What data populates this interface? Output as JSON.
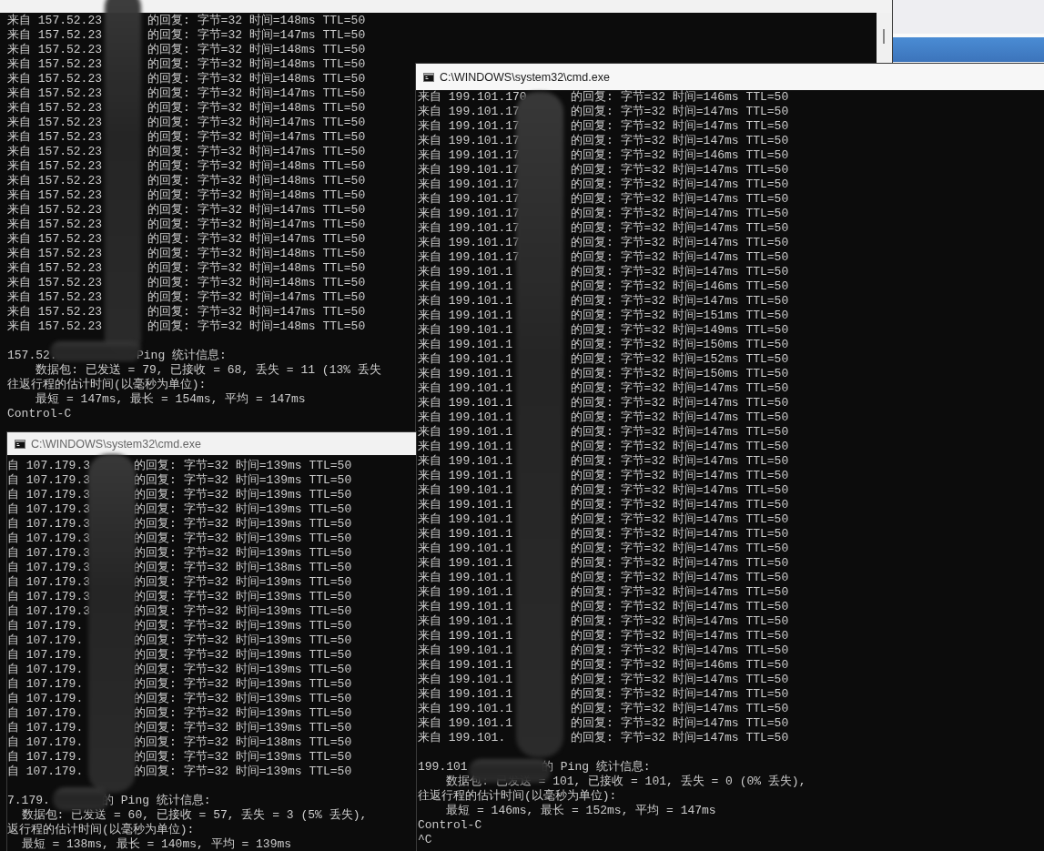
{
  "windows": [
    {
      "replies": [
        {
          "source": "来自 157.52.23",
          "reply": "的回复: 字节=32 时间=148ms TTL=50"
        },
        {
          "source": "来自 157.52.23",
          "reply": "的回复: 字节=32 时间=147ms TTL=50"
        },
        {
          "source": "来自 157.52.23",
          "reply": "的回复: 字节=32 时间=148ms TTL=50"
        },
        {
          "source": "来自 157.52.23",
          "reply": "的回复: 字节=32 时间=148ms TTL=50"
        },
        {
          "source": "来自 157.52.23",
          "reply": "的回复: 字节=32 时间=148ms TTL=50"
        },
        {
          "source": "来自 157.52.23",
          "reply": "的回复: 字节=32 时间=147ms TTL=50"
        },
        {
          "source": "来自 157.52.23",
          "reply": "的回复: 字节=32 时间=148ms TTL=50"
        },
        {
          "source": "来自 157.52.23",
          "reply": "的回复: 字节=32 时间=147ms TTL=50"
        },
        {
          "source": "来自 157.52.23",
          "reply": "的回复: 字节=32 时间=147ms TTL=50"
        },
        {
          "source": "来自 157.52.23",
          "reply": "的回复: 字节=32 时间=147ms TTL=50"
        },
        {
          "source": "来自 157.52.23",
          "reply": "的回复: 字节=32 时间=148ms TTL=50"
        },
        {
          "source": "来自 157.52.23",
          "reply": "的回复: 字节=32 时间=148ms TTL=50"
        },
        {
          "source": "来自 157.52.23",
          "reply": "的回复: 字节=32 时间=148ms TTL=50"
        },
        {
          "source": "来自 157.52.23",
          "reply": "的回复: 字节=32 时间=147ms TTL=50"
        },
        {
          "source": "来自 157.52.23",
          "reply": "的回复: 字节=32 时间=147ms TTL=50"
        },
        {
          "source": "来自 157.52.23",
          "reply": "的回复: 字节=32 时间=147ms TTL=50"
        },
        {
          "source": "来自 157.52.23",
          "reply": "的回复: 字节=32 时间=148ms TTL=50"
        },
        {
          "source": "来自 157.52.23",
          "reply": "的回复: 字节=32 时间=148ms TTL=50"
        },
        {
          "source": "来自 157.52.23",
          "reply": "的回复: 字节=32 时间=148ms TTL=50"
        },
        {
          "source": "来自 157.52.23",
          "reply": "的回复: 字节=32 时间=147ms TTL=50"
        },
        {
          "source": "来自 157.52.23",
          "reply": "的回复: 字节=32 时间=147ms TTL=50"
        },
        {
          "source": "来自 157.52.23",
          "reply": "的回复: 字节=32 时间=148ms TTL=50"
        }
      ],
      "stats_header": {
        "source": "157.52.",
        "text": "Ping 统计信息:"
      },
      "stats": [
        "    数据包: 已发送 = 79, 已接收 = 68, 丢失 = 11 (13% 丢失",
        "往返行程的估计时间(以毫秒为单位):",
        "    最短 = 147ms, 最长 = 154ms, 平均 = 147ms",
        "Control-C"
      ]
    },
    {
      "title": "C:\\WINDOWS\\system32\\cmd.exe",
      "replies": [
        {
          "source": "来自 199.101.170",
          "reply": "的回复: 字节=32 时间=146ms TTL=50"
        },
        {
          "source": "来自 199.101.17",
          "reply": "的回复: 字节=32 时间=147ms TTL=50"
        },
        {
          "source": "来自 199.101.17",
          "reply": "的回复: 字节=32 时间=147ms TTL=50"
        },
        {
          "source": "来自 199.101.17",
          "reply": "的回复: 字节=32 时间=147ms TTL=50"
        },
        {
          "source": "来自 199.101.17",
          "reply": "的回复: 字节=32 时间=146ms TTL=50"
        },
        {
          "source": "来自 199.101.17",
          "reply": "的回复: 字节=32 时间=147ms TTL=50"
        },
        {
          "source": "来自 199.101.17",
          "reply": "的回复: 字节=32 时间=147ms TTL=50"
        },
        {
          "source": "来自 199.101.17",
          "reply": "的回复: 字节=32 时间=147ms TTL=50"
        },
        {
          "source": "来自 199.101.17",
          "reply": "的回复: 字节=32 时间=147ms TTL=50"
        },
        {
          "source": "来自 199.101.17",
          "reply": "的回复: 字节=32 时间=147ms TTL=50"
        },
        {
          "source": "来自 199.101.17",
          "reply": "的回复: 字节=32 时间=147ms TTL=50"
        },
        {
          "source": "来自 199.101.17",
          "reply": "的回复: 字节=32 时间=147ms TTL=50"
        },
        {
          "source": "来自 199.101.1",
          "reply": "的回复: 字节=32 时间=147ms TTL=50"
        },
        {
          "source": "来自 199.101.1",
          "reply": "的回复: 字节=32 时间=146ms TTL=50"
        },
        {
          "source": "来自 199.101.1",
          "reply": "的回复: 字节=32 时间=147ms TTL=50"
        },
        {
          "source": "来自 199.101.1",
          "reply": "的回复: 字节=32 时间=151ms TTL=50"
        },
        {
          "source": "来自 199.101.1",
          "reply": "的回复: 字节=32 时间=149ms TTL=50"
        },
        {
          "source": "来自 199.101.1",
          "reply": "的回复: 字节=32 时间=150ms TTL=50"
        },
        {
          "source": "来自 199.101.1",
          "reply": "的回复: 字节=32 时间=152ms TTL=50"
        },
        {
          "source": "来自 199.101.1",
          "reply": "的回复: 字节=32 时间=150ms TTL=50"
        },
        {
          "source": "来自 199.101.1",
          "reply": "的回复: 字节=32 时间=147ms TTL=50"
        },
        {
          "source": "来自 199.101.1",
          "reply": "的回复: 字节=32 时间=147ms TTL=50"
        },
        {
          "source": "来自 199.101.1",
          "reply": "的回复: 字节=32 时间=147ms TTL=50"
        },
        {
          "source": "来自 199.101.1",
          "reply": "的回复: 字节=32 时间=147ms TTL=50"
        },
        {
          "source": "来自 199.101.1",
          "reply": "的回复: 字节=32 时间=147ms TTL=50"
        },
        {
          "source": "来自 199.101.1",
          "reply": "的回复: 字节=32 时间=147ms TTL=50"
        },
        {
          "source": "来自 199.101.1",
          "reply": "的回复: 字节=32 时间=147ms TTL=50"
        },
        {
          "source": "来自 199.101.1",
          "reply": "的回复: 字节=32 时间=147ms TTL=50"
        },
        {
          "source": "来自 199.101.1",
          "reply": "的回复: 字节=32 时间=147ms TTL=50"
        },
        {
          "source": "来自 199.101.1",
          "reply": "的回复: 字节=32 时间=147ms TTL=50"
        },
        {
          "source": "来自 199.101.1",
          "reply": "的回复: 字节=32 时间=147ms TTL=50"
        },
        {
          "source": "来自 199.101.1",
          "reply": "的回复: 字节=32 时间=147ms TTL=50"
        },
        {
          "source": "来自 199.101.1",
          "reply": "的回复: 字节=32 时间=147ms TTL=50"
        },
        {
          "source": "来自 199.101.1",
          "reply": "的回复: 字节=32 时间=147ms TTL=50"
        },
        {
          "source": "来自 199.101.1",
          "reply": "的回复: 字节=32 时间=147ms TTL=50"
        },
        {
          "source": "来自 199.101.1",
          "reply": "的回复: 字节=32 时间=147ms TTL=50"
        },
        {
          "source": "来自 199.101.1",
          "reply": "的回复: 字节=32 时间=147ms TTL=50"
        },
        {
          "source": "来自 199.101.1",
          "reply": "的回复: 字节=32 时间=147ms TTL=50"
        },
        {
          "source": "来自 199.101.1",
          "reply": "的回复: 字节=32 时间=147ms TTL=50"
        },
        {
          "source": "来自 199.101.1",
          "reply": "的回复: 字节=32 时间=146ms TTL=50"
        },
        {
          "source": "来自 199.101.1",
          "reply": "的回复: 字节=32 时间=147ms TTL=50"
        },
        {
          "source": "来自 199.101.1",
          "reply": "的回复: 字节=32 时间=147ms TTL=50"
        },
        {
          "source": "来自 199.101.1",
          "reply": "的回复: 字节=32 时间=147ms TTL=50"
        },
        {
          "source": "来自 199.101.1",
          "reply": "的回复: 字节=32 时间=147ms TTL=50"
        },
        {
          "source": "来自 199.101.",
          "reply": "的回复: 字节=32 时间=147ms TTL=50"
        }
      ],
      "stats_header": {
        "source": "199.101",
        "text": "的 Ping 统计信息:"
      },
      "stats": [
        "    数据包: 已发送 = 101, 已接收 = 101, 丢失 = 0 (0% 丢失),",
        "往返行程的估计时间(以毫秒为单位):",
        "    最短 = 146ms, 最长 = 152ms, 平均 = 147ms",
        "Control-C",
        "^C"
      ]
    },
    {
      "title": "C:\\WINDOWS\\system32\\cmd.exe",
      "replies": [
        {
          "source": "自 107.179.3",
          "reply": "的回复: 字节=32 时间=139ms TTL=50"
        },
        {
          "source": "自 107.179.3",
          "reply": "的回复: 字节=32 时间=139ms TTL=50"
        },
        {
          "source": "自 107.179.3",
          "reply": "的回复: 字节=32 时间=139ms TTL=50"
        },
        {
          "source": "自 107.179.3",
          "reply": "的回复: 字节=32 时间=139ms TTL=50"
        },
        {
          "source": "自 107.179.3",
          "reply": "的回复: 字节=32 时间=139ms TTL=50"
        },
        {
          "source": "自 107.179.3",
          "reply": "的回复: 字节=32 时间=139ms TTL=50"
        },
        {
          "source": "自 107.179.3",
          "reply": "的回复: 字节=32 时间=139ms TTL=50"
        },
        {
          "source": "自 107.179.3",
          "reply": "的回复: 字节=32 时间=138ms TTL=50"
        },
        {
          "source": "自 107.179.3",
          "reply": "的回复: 字节=32 时间=139ms TTL=50"
        },
        {
          "source": "自 107.179.3",
          "reply": "的回复: 字节=32 时间=139ms TTL=50"
        },
        {
          "source": "自 107.179.3",
          "reply": "的回复: 字节=32 时间=139ms TTL=50"
        },
        {
          "source": "自 107.179.",
          "reply": "的回复: 字节=32 时间=139ms TTL=50"
        },
        {
          "source": "自 107.179.",
          "reply": "的回复: 字节=32 时间=139ms TTL=50"
        },
        {
          "source": "自 107.179.",
          "reply": "的回复: 字节=32 时间=139ms TTL=50"
        },
        {
          "source": "自 107.179.",
          "reply": "的回复: 字节=32 时间=139ms TTL=50"
        },
        {
          "source": "自 107.179.",
          "reply": "的回复: 字节=32 时间=139ms TTL=50"
        },
        {
          "source": "自 107.179.",
          "reply": "的回复: 字节=32 时间=139ms TTL=50"
        },
        {
          "source": "自 107.179.",
          "reply": "的回复: 字节=32 时间=139ms TTL=50"
        },
        {
          "source": "自 107.179.",
          "reply": "的回复: 字节=32 时间=139ms TTL=50"
        },
        {
          "source": "自 107.179.",
          "reply": "的回复: 字节=32 时间=138ms TTL=50"
        },
        {
          "source": "自 107.179.",
          "reply": "的回复: 字节=32 时间=139ms TTL=50"
        },
        {
          "source": "自 107.179.",
          "reply": "的回复: 字节=32 时间=139ms TTL=50"
        }
      ],
      "stats_header": {
        "source": "7.179.",
        "text": "的 Ping 统计信息:"
      },
      "stats": [
        "  数据包: 已发送 = 60, 已接收 = 57, 丢失 = 3 (5% 丢失),",
        "返行程的估计时间(以毫秒为单位):",
        "  最短 = 138ms, 最长 = 140ms, 平均 = 139ms"
      ]
    }
  ]
}
